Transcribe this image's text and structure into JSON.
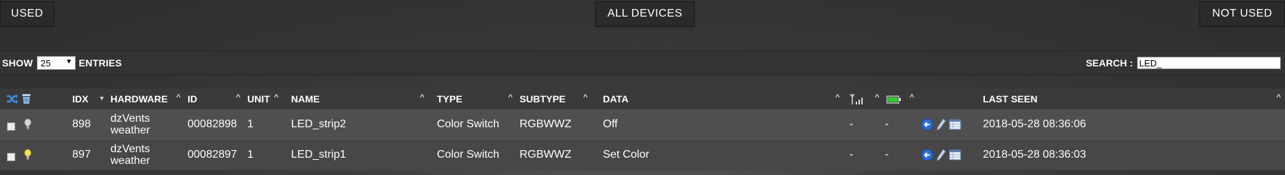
{
  "filter_buttons": {
    "used": "USED",
    "all_devices": "ALL DEVICES",
    "not_used": "NOT USED"
  },
  "controls": {
    "show_label": "SHOW",
    "entries_value": "25",
    "entries_label": "ENTRIES",
    "search_label": "SEARCH :",
    "search_value": "LED_"
  },
  "table": {
    "headers": {
      "idx": "IDX",
      "hardware": "HARDWARE",
      "id": "ID",
      "unit": "UNIT",
      "name": "NAME",
      "type": "TYPE",
      "subtype": "SUBTYPE",
      "data": "DATA",
      "last_seen": "LAST SEEN"
    },
    "rows": [
      {
        "idx": "898",
        "hardware_line1": "dzVents",
        "hardware_line2": "weather",
        "id": "00082898",
        "unit": "1",
        "name": "LED_strip2",
        "type": "Color Switch",
        "subtype": "RGBWWZ",
        "data": "Off",
        "signal": "-",
        "battery": "-",
        "last_seen": "2018-05-28 08:36:06",
        "bulb_icon": "bulb-off-icon"
      },
      {
        "idx": "897",
        "hardware_line1": "dzVents",
        "hardware_line2": "weather",
        "id": "00082897",
        "unit": "1",
        "name": "LED_strip1",
        "type": "Color Switch",
        "subtype": "RGBWWZ",
        "data": "Set Color",
        "signal": "-",
        "battery": "-",
        "last_seen": "2018-05-28 08:36:03",
        "bulb_icon": "bulb-on-icon"
      }
    ]
  },
  "colors": {
    "row_odd": "#4f4f4f",
    "row_even": "#474747",
    "header_bg": "#3a3a3a",
    "accent_blue": "#2a6fd6",
    "bulb_on": "#f2e24a",
    "battery_green": "#2ecc2e"
  }
}
